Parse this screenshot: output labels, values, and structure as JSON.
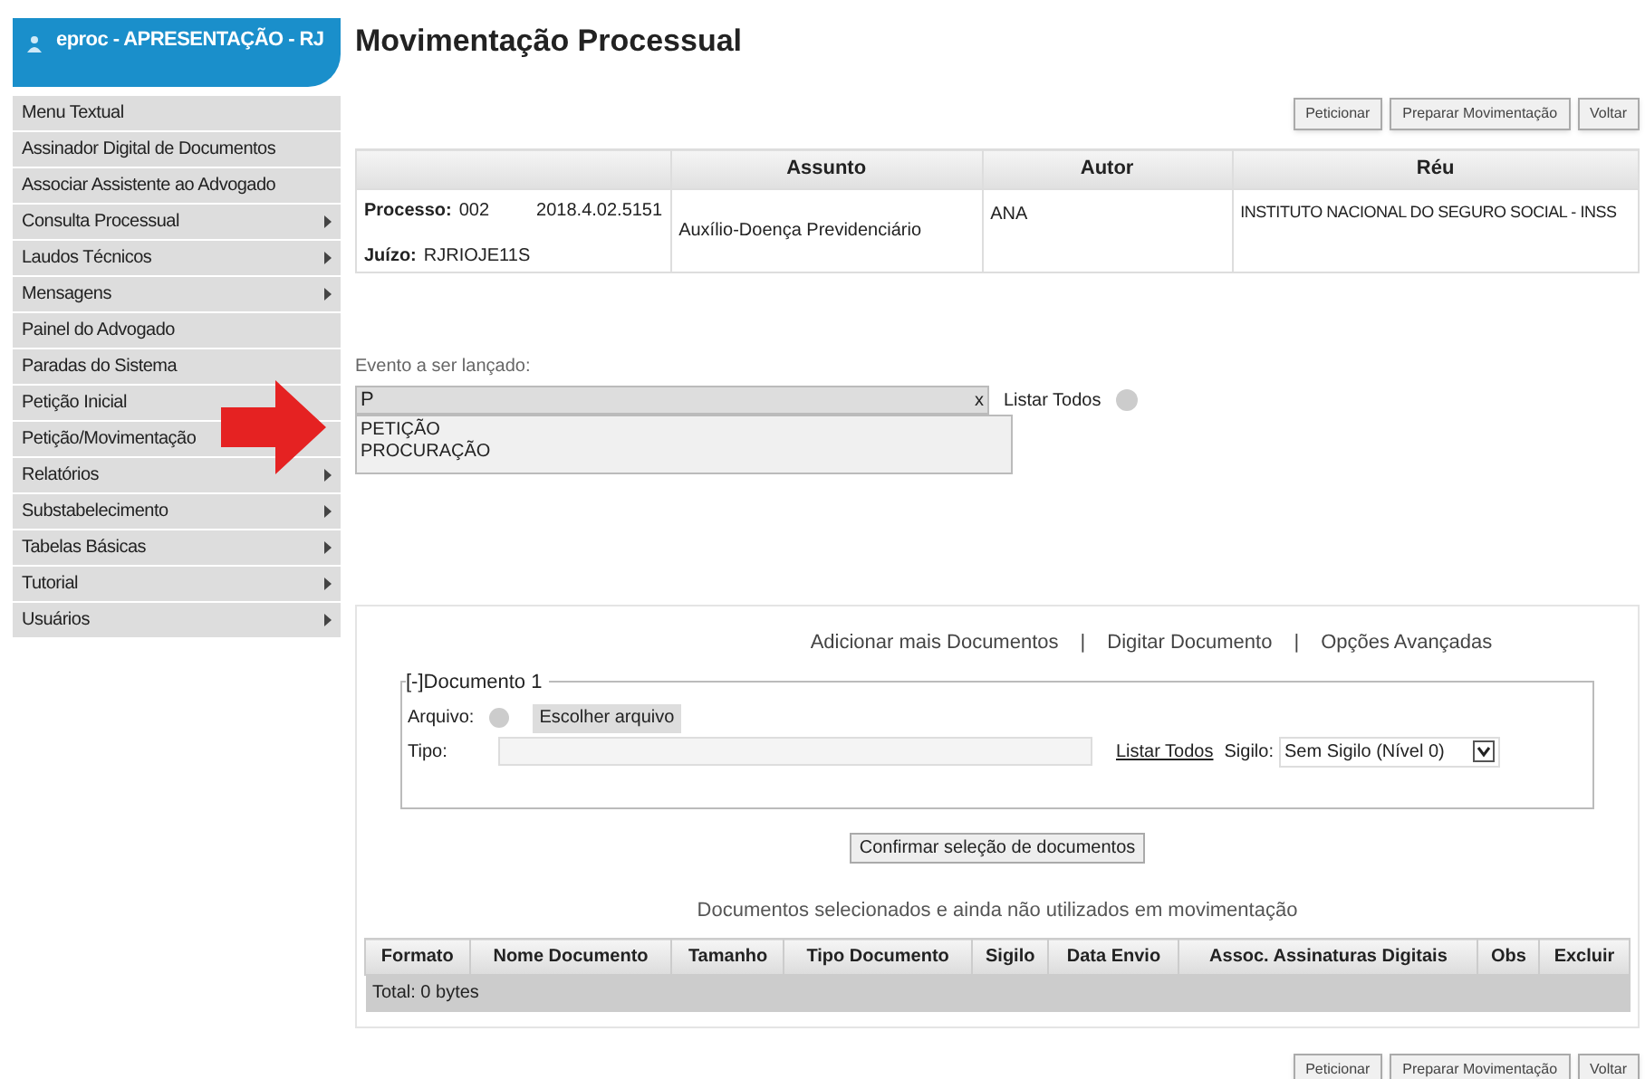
{
  "header": {
    "title": "eproc - APRESENTAÇÃO - RJ"
  },
  "sidebar": {
    "items": [
      {
        "label": "Menu Textual",
        "submenu": false
      },
      {
        "label": "Assinador Digital de Documentos",
        "submenu": false
      },
      {
        "label": "Associar Assistente ao Advogado",
        "submenu": false
      },
      {
        "label": "Consulta Processual",
        "submenu": true
      },
      {
        "label": "Laudos Técnicos",
        "submenu": true
      },
      {
        "label": "Mensagens",
        "submenu": true
      },
      {
        "label": "Painel do Advogado",
        "submenu": false
      },
      {
        "label": "Paradas do Sistema",
        "submenu": false
      },
      {
        "label": "Petição Inicial",
        "submenu": false
      },
      {
        "label": "Petição/Movimentação",
        "submenu": false
      },
      {
        "label": "Relatórios",
        "submenu": true
      },
      {
        "label": "Substabelecimento",
        "submenu": true
      },
      {
        "label": "Tabelas Básicas",
        "submenu": true
      },
      {
        "label": "Tutorial",
        "submenu": true
      },
      {
        "label": "Usuários",
        "submenu": true
      }
    ]
  },
  "page_title": "Movimentação Processual",
  "top_buttons": [
    "Peticionar",
    "Preparar Movimentação",
    "Voltar"
  ],
  "process_table": {
    "columns": [
      "",
      "Assunto",
      "Autor",
      "Réu"
    ],
    "processo_label": "Processo:",
    "processo_number": "002",
    "processo_code": "2018.4.02.5151",
    "juizo_label": "Juízo:",
    "juizo_value": "RJRIOJE11S",
    "assunto": "Auxílio-Doença Previdenciário",
    "autor": "ANA",
    "reu": "INSTITUTO NACIONAL DO SEGURO SOCIAL - INSS"
  },
  "event": {
    "label": "Evento a ser lançado:",
    "value": "P",
    "clear": "x",
    "list_all": "Listar Todos",
    "suggestions": [
      "PETIÇÃO",
      "PROCURAÇÃO"
    ]
  },
  "documents": {
    "links": [
      "Adicionar mais Documentos",
      "Digitar Documento",
      "Opções Avançadas"
    ],
    "separator": "|",
    "fieldset": "[-]Documento 1",
    "arquivo_label": "Arquivo:",
    "file_button": "Escolher arquivo",
    "tipo_label": "Tipo:",
    "list_all": "Listar Todos",
    "sigilo_label": "Sigilo:",
    "sigilo_value": "Sem Sigilo (Nível 0)",
    "confirm_button": "Confirmar seleção de documentos",
    "table_title": "Documentos selecionados e ainda não utilizados em movimentação",
    "columns": [
      "Formato",
      "Nome Documento",
      "Tamanho",
      "Tipo Documento",
      "Sigilo",
      "Data Envio",
      "Assoc. Assinaturas Digitais",
      "Obs",
      "Excluir"
    ],
    "total": "Total: 0 bytes"
  },
  "bottom_buttons": [
    "Peticionar",
    "Preparar Movimentação",
    "Voltar"
  ]
}
